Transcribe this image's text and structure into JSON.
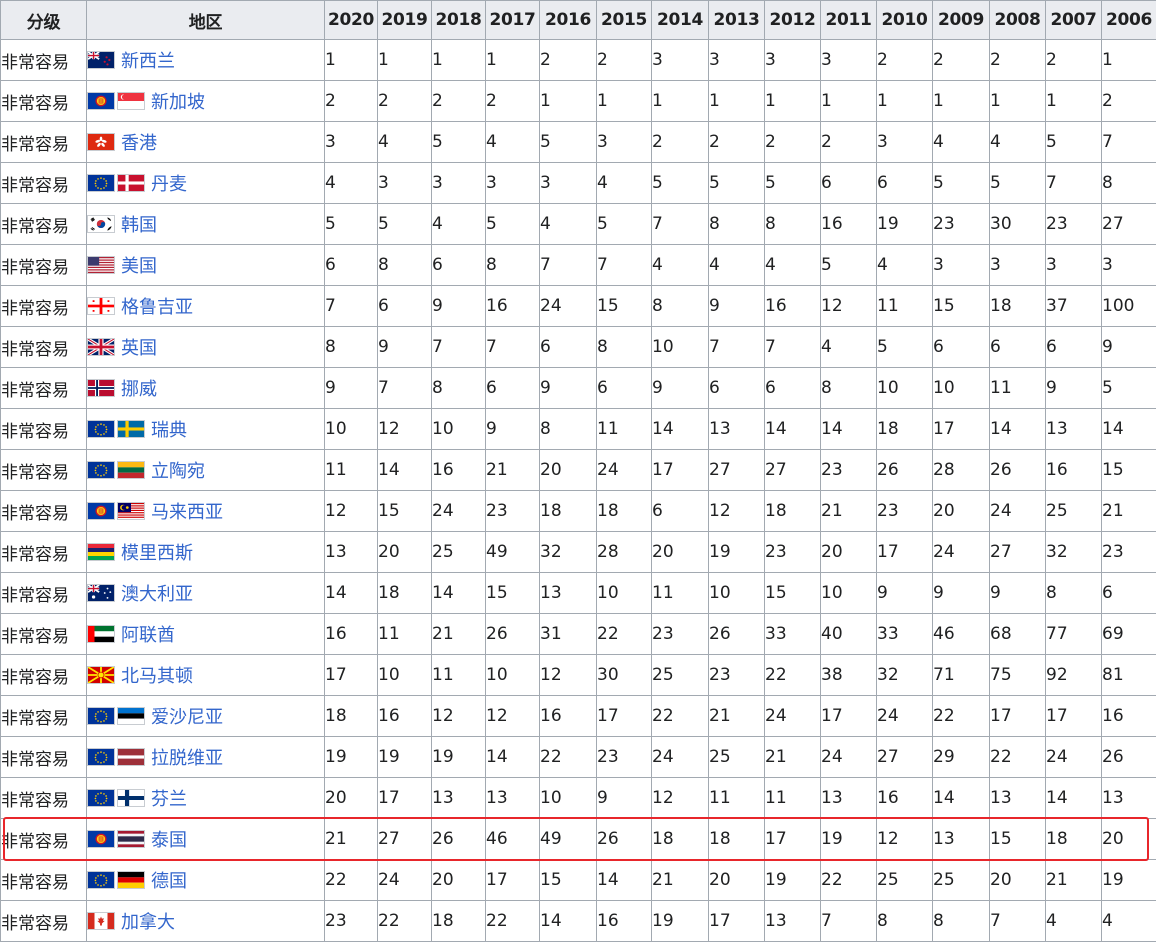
{
  "table": {
    "headers": [
      "分级",
      "地区",
      "2020",
      "2019",
      "2018",
      "2017",
      "2016",
      "2015",
      "2014",
      "2013",
      "2012",
      "2011",
      "2010",
      "2009",
      "2008",
      "2007",
      "2006"
    ],
    "rows": [
      {
        "category": "非常容易",
        "region": "新西兰",
        "flags": [
          "nz-flag-icon"
        ],
        "values": [
          "1",
          "1",
          "1",
          "1",
          "2",
          "2",
          "3",
          "3",
          "3",
          "3",
          "2",
          "2",
          "2",
          "2",
          "1"
        ]
      },
      {
        "category": "非常容易",
        "region": "新加坡",
        "flags": [
          "asean-flag-icon",
          "sg-flag-icon"
        ],
        "values": [
          "2",
          "2",
          "2",
          "2",
          "1",
          "1",
          "1",
          "1",
          "1",
          "1",
          "1",
          "1",
          "1",
          "1",
          "2"
        ]
      },
      {
        "category": "非常容易",
        "region": "香港",
        "flags": [
          "hk-flag-icon"
        ],
        "values": [
          "3",
          "4",
          "5",
          "4",
          "5",
          "3",
          "2",
          "2",
          "2",
          "2",
          "3",
          "4",
          "4",
          "5",
          "7"
        ]
      },
      {
        "category": "非常容易",
        "region": "丹麦",
        "flags": [
          "eu-flag-icon",
          "dk-flag-icon"
        ],
        "values": [
          "4",
          "3",
          "3",
          "3",
          "3",
          "4",
          "5",
          "5",
          "5",
          "6",
          "6",
          "5",
          "5",
          "7",
          "8"
        ]
      },
      {
        "category": "非常容易",
        "region": "韩国",
        "flags": [
          "kr-flag-icon"
        ],
        "values": [
          "5",
          "5",
          "4",
          "5",
          "4",
          "5",
          "7",
          "8",
          "8",
          "16",
          "19",
          "23",
          "30",
          "23",
          "27"
        ]
      },
      {
        "category": "非常容易",
        "region": "美国",
        "flags": [
          "us-flag-icon"
        ],
        "values": [
          "6",
          "8",
          "6",
          "8",
          "7",
          "7",
          "4",
          "4",
          "4",
          "5",
          "4",
          "3",
          "3",
          "3",
          "3"
        ]
      },
      {
        "category": "非常容易",
        "region": "格鲁吉亚",
        "flags": [
          "ge-flag-icon"
        ],
        "values": [
          "7",
          "6",
          "9",
          "16",
          "24",
          "15",
          "8",
          "9",
          "16",
          "12",
          "11",
          "15",
          "18",
          "37",
          "100"
        ]
      },
      {
        "category": "非常容易",
        "region": "英国",
        "flags": [
          "gb-flag-icon"
        ],
        "values": [
          "8",
          "9",
          "7",
          "7",
          "6",
          "8",
          "10",
          "7",
          "7",
          "4",
          "5",
          "6",
          "6",
          "6",
          "9"
        ]
      },
      {
        "category": "非常容易",
        "region": "挪威",
        "flags": [
          "no-flag-icon"
        ],
        "values": [
          "9",
          "7",
          "8",
          "6",
          "9",
          "6",
          "9",
          "6",
          "6",
          "8",
          "10",
          "10",
          "11",
          "9",
          "5"
        ]
      },
      {
        "category": "非常容易",
        "region": "瑞典",
        "flags": [
          "eu-flag-icon",
          "se-flag-icon"
        ],
        "values": [
          "10",
          "12",
          "10",
          "9",
          "8",
          "11",
          "14",
          "13",
          "14",
          "14",
          "18",
          "17",
          "14",
          "13",
          "14"
        ]
      },
      {
        "category": "非常容易",
        "region": "立陶宛",
        "flags": [
          "eu-flag-icon",
          "lt-flag-icon"
        ],
        "values": [
          "11",
          "14",
          "16",
          "21",
          "20",
          "24",
          "17",
          "27",
          "27",
          "23",
          "26",
          "28",
          "26",
          "16",
          "15"
        ]
      },
      {
        "category": "非常容易",
        "region": "马来西亚",
        "flags": [
          "asean-flag-icon",
          "my-flag-icon"
        ],
        "values": [
          "12",
          "15",
          "24",
          "23",
          "18",
          "18",
          "6",
          "12",
          "18",
          "21",
          "23",
          "20",
          "24",
          "25",
          "21"
        ]
      },
      {
        "category": "非常容易",
        "region": "模里西斯",
        "flags": [
          "mu-flag-icon"
        ],
        "values": [
          "13",
          "20",
          "25",
          "49",
          "32",
          "28",
          "20",
          "19",
          "23",
          "20",
          "17",
          "24",
          "27",
          "32",
          "23"
        ]
      },
      {
        "category": "非常容易",
        "region": "澳大利亚",
        "flags": [
          "au-flag-icon"
        ],
        "values": [
          "14",
          "18",
          "14",
          "15",
          "13",
          "10",
          "11",
          "10",
          "15",
          "10",
          "9",
          "9",
          "9",
          "8",
          "6"
        ]
      },
      {
        "category": "非常容易",
        "region": "阿联酋",
        "flags": [
          "ae-flag-icon"
        ],
        "values": [
          "16",
          "11",
          "21",
          "26",
          "31",
          "22",
          "23",
          "26",
          "33",
          "40",
          "33",
          "46",
          "68",
          "77",
          "69"
        ]
      },
      {
        "category": "非常容易",
        "region": "北马其顿",
        "flags": [
          "mk-flag-icon"
        ],
        "values": [
          "17",
          "10",
          "11",
          "10",
          "12",
          "30",
          "25",
          "23",
          "22",
          "38",
          "32",
          "71",
          "75",
          "92",
          "81"
        ]
      },
      {
        "category": "非常容易",
        "region": "爱沙尼亚",
        "flags": [
          "eu-flag-icon",
          "ee-flag-icon"
        ],
        "values": [
          "18",
          "16",
          "12",
          "12",
          "16",
          "17",
          "22",
          "21",
          "24",
          "17",
          "24",
          "22",
          "17",
          "17",
          "16"
        ]
      },
      {
        "category": "非常容易",
        "region": "拉脱维亚",
        "flags": [
          "eu-flag-icon",
          "lv-flag-icon"
        ],
        "values": [
          "19",
          "19",
          "19",
          "14",
          "22",
          "23",
          "24",
          "25",
          "21",
          "24",
          "27",
          "29",
          "22",
          "24",
          "26"
        ]
      },
      {
        "category": "非常容易",
        "region": "芬兰",
        "flags": [
          "eu-flag-icon",
          "fi-flag-icon"
        ],
        "values": [
          "20",
          "17",
          "13",
          "13",
          "10",
          "9",
          "12",
          "11",
          "11",
          "13",
          "16",
          "14",
          "13",
          "14",
          "13"
        ]
      },
      {
        "category": "非常容易",
        "region": "泰国",
        "flags": [
          "asean-flag-icon",
          "th-flag-icon"
        ],
        "values": [
          "21",
          "27",
          "26",
          "46",
          "49",
          "26",
          "18",
          "18",
          "17",
          "19",
          "12",
          "13",
          "15",
          "18",
          "20"
        ]
      },
      {
        "category": "非常容易",
        "region": "德国",
        "flags": [
          "eu-flag-icon",
          "de-flag-icon"
        ],
        "values": [
          "22",
          "24",
          "20",
          "17",
          "15",
          "14",
          "21",
          "20",
          "19",
          "22",
          "25",
          "25",
          "20",
          "21",
          "19"
        ]
      },
      {
        "category": "非常容易",
        "region": "加拿大",
        "flags": [
          "ca-flag-icon"
        ],
        "values": [
          "23",
          "22",
          "18",
          "22",
          "14",
          "16",
          "19",
          "17",
          "13",
          "7",
          "8",
          "8",
          "7",
          "4",
          "4"
        ]
      }
    ],
    "highlighted_region": "泰国"
  },
  "colors": {
    "link": "#3366cc",
    "header_bg": "#eaecf0",
    "border": "#a2a9b1",
    "highlight": "#e8262b"
  }
}
